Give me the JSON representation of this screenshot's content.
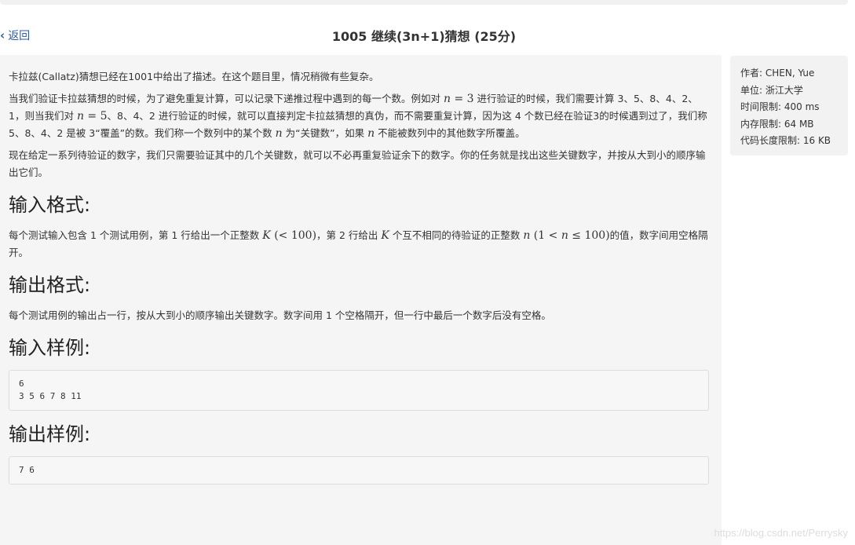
{
  "nav": {
    "back_label": "返回"
  },
  "title": "1005 继续(3n+1)猜想 (25分)",
  "problem": {
    "para1": "卡拉兹(Callatz)猜想已经在1001中给出了描述。在这个题目里，情况稍微有些复杂。",
    "para2": {
      "a": "当我们验证卡拉兹猜想的时候，为了避免重复计算，可以记录下递推过程中遇到的每一个数。例如对 ",
      "m1": "n",
      "m1b": " = 3",
      "b": " 进行验证的时候，我们需要计算 3、5、8、4、2、1，则当我们对 ",
      "m2": "n",
      "m2b": " = 5",
      "c": "、8、4、2 进行验证的时候，就可以直接判定卡拉兹猜想的真伪，而不需要重复计算，因为这 4 个数已经在验证3的时候遇到过了，我们称 5、8、4、2 是被 3“覆盖”的数。我们称一个数列中的某个数 ",
      "m3": "n",
      "d": " 为“关键数”，如果 ",
      "m4": "n",
      "e": " 不能被数列中的其他数字所覆盖。"
    },
    "para3": "现在给定一系列待验证的数字，我们只需要验证其中的几个关键数，就可以不必再重复验证余下的数字。你的任务就是找出这些关键数字，并按从大到小的顺序输出它们。",
    "input_heading": "输入格式:",
    "input_desc": {
      "a": "每个测试输入包含 1 个测试用例，第 1 行给出一个正整数 ",
      "m1": "K",
      "m1b": " (< 100)",
      "b": "，第 2 行给出 ",
      "m2": "K",
      "c": " 个互不相同的待验证的正整数 ",
      "m3": "n",
      "m3b": " (1 < ",
      "m3c": "n",
      "m3d": " ≤ 100)",
      "d": "的值，数字间用空格隔开。"
    },
    "output_heading": "输出格式:",
    "output_desc": "每个测试用例的输出占一行，按从大到小的顺序输出关键数字。数字间用 1 个空格隔开，但一行中最后一个数字后没有空格。",
    "sample_input_heading": "输入样例:",
    "sample_input": "6\n3 5 6 7 8 11",
    "sample_output_heading": "输出样例:",
    "sample_output": "7 6"
  },
  "info": {
    "author": "作者: CHEN, Yue",
    "unit": "单位: 浙江大学",
    "time_limit": "时间限制: 400 ms",
    "memory_limit": "内存限制: 64 MB",
    "code_limit": "代码长度限制: 16 KB"
  },
  "watermark": "https://blog.csdn.net/Perrysky"
}
